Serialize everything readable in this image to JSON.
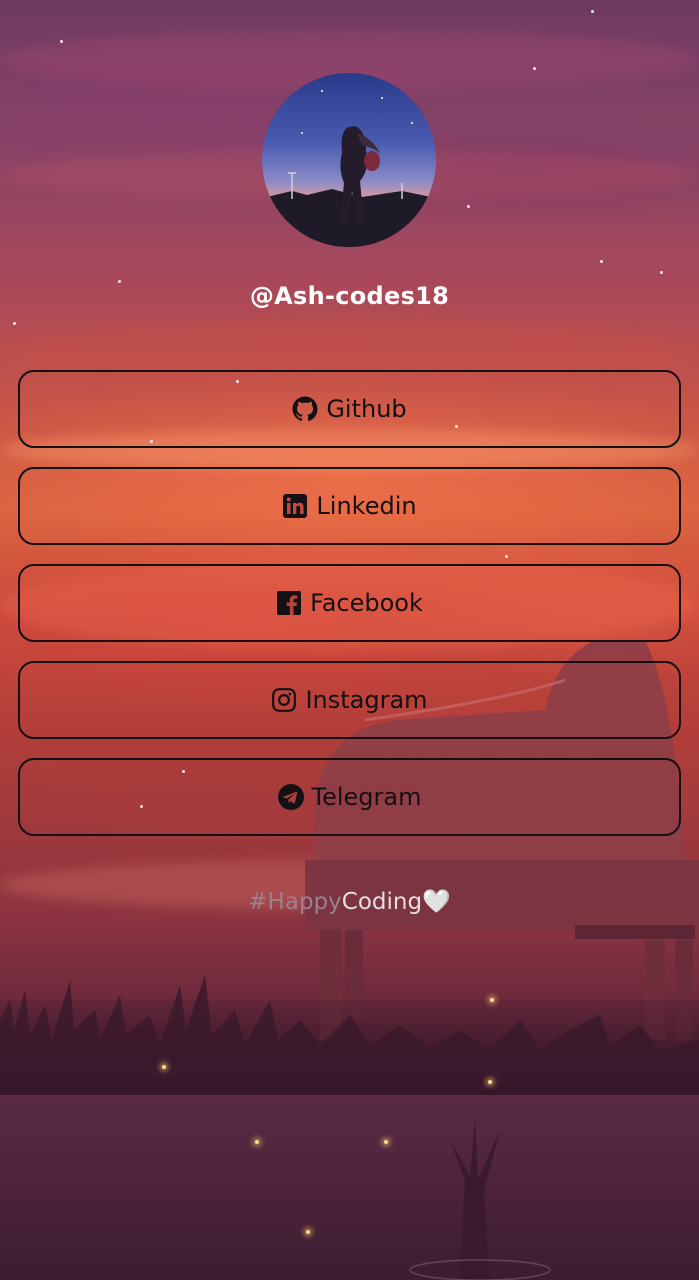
{
  "profile": {
    "username": "@Ash-codes18"
  },
  "links": [
    {
      "label": "Github",
      "icon": "github-icon"
    },
    {
      "label": "Linkedin",
      "icon": "linkedin-icon"
    },
    {
      "label": "Facebook",
      "icon": "facebook-icon"
    },
    {
      "label": "Instagram",
      "icon": "instagram-icon"
    },
    {
      "label": "Telegram",
      "icon": "telegram-icon"
    }
  ],
  "footer": {
    "hash_part": "#Happy",
    "coding_part": "Coding",
    "heart": "🤍"
  },
  "colors": {
    "button_border": "#141014",
    "button_text": "#141014",
    "username_text": "#ffffff"
  }
}
